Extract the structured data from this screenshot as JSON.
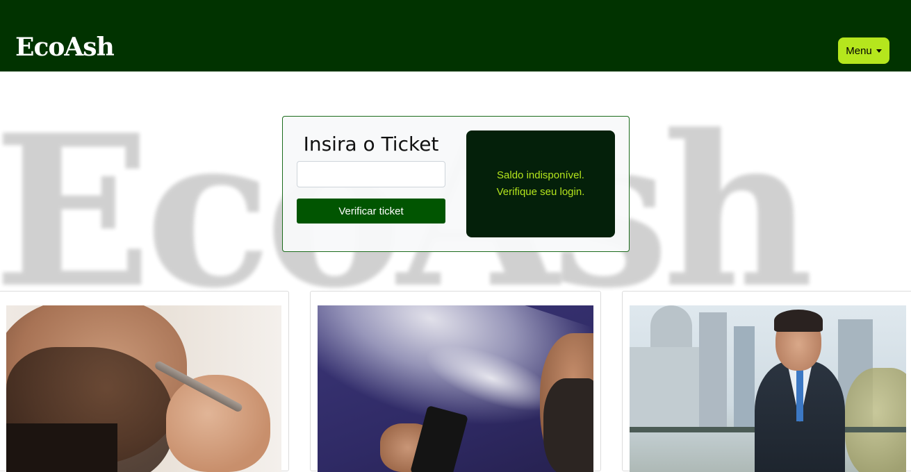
{
  "header": {
    "brand": "EcoAsh",
    "menu_label": "Menu"
  },
  "watermark": {
    "text": "EcoAsh"
  },
  "ticket": {
    "title": "Insira o Ticket",
    "input_value": "",
    "input_placeholder": "",
    "verify_label": "Verificar ticket",
    "balance_message": "Saldo indisponível. Verifique seu login."
  },
  "cards": [
    {
      "image": "man-vaping-pen-photo"
    },
    {
      "image": "man-exhaling-vapor-photo"
    },
    {
      "image": "businessman-city-photo"
    }
  ],
  "colors": {
    "header_bg": "#013300",
    "menu_bg": "#b5e61d",
    "verify_bg": "#015501",
    "balance_bg": "#04200a",
    "balance_text": "#b5e61d"
  }
}
